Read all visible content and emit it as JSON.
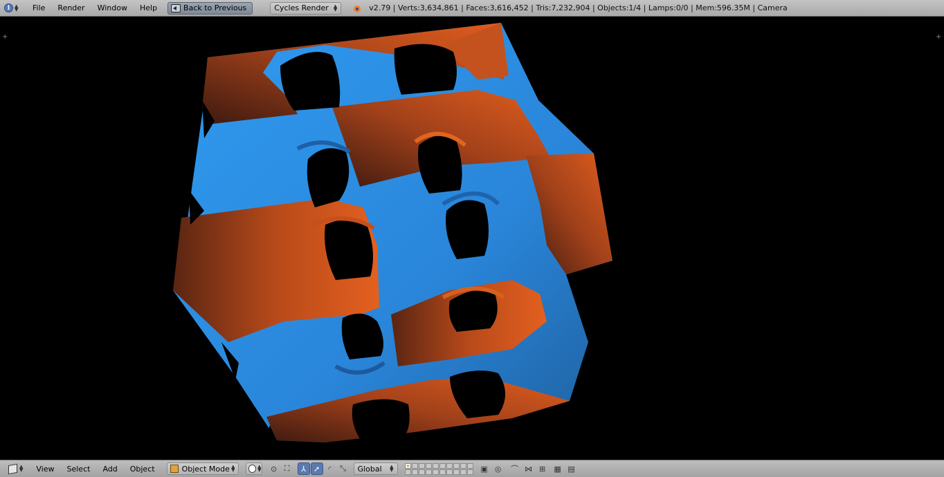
{
  "top_header": {
    "menus": [
      "File",
      "Render",
      "Window",
      "Help"
    ],
    "back_button": "Back to Previous",
    "render_engine": "Cycles Render",
    "stats": "v2.79 | Verts:3,634,861 | Faces:3,616,452 | Tris:7,232,904 | Objects:1/4 | Lamps:0/0 | Mem:596.35M | Camera"
  },
  "bottom_header": {
    "menus": [
      "View",
      "Select",
      "Add",
      "Object"
    ],
    "mode": "Object Mode",
    "orientation": "Global"
  },
  "viewport": {
    "background_color": "#000000",
    "mesh_colors": {
      "blue": "#2b8fe8",
      "orange": "#d8551c",
      "dark": "#3a1a10"
    }
  },
  "icons": {
    "editor_type": "info-icon",
    "engine_logo": "blender-logo-icon",
    "view3d_type": "cube-icon",
    "mode": "object-mode-icon",
    "shading": "solid-sphere-icon",
    "pivot": "pivot-icon",
    "manipulator": "manipulator-icon",
    "translate": "translate-arrow-icon",
    "rotate": "rotate-arc-icon",
    "scale": "scale-icon",
    "render_camera": "camera-icon",
    "render_clapper": "clapper-icon"
  }
}
